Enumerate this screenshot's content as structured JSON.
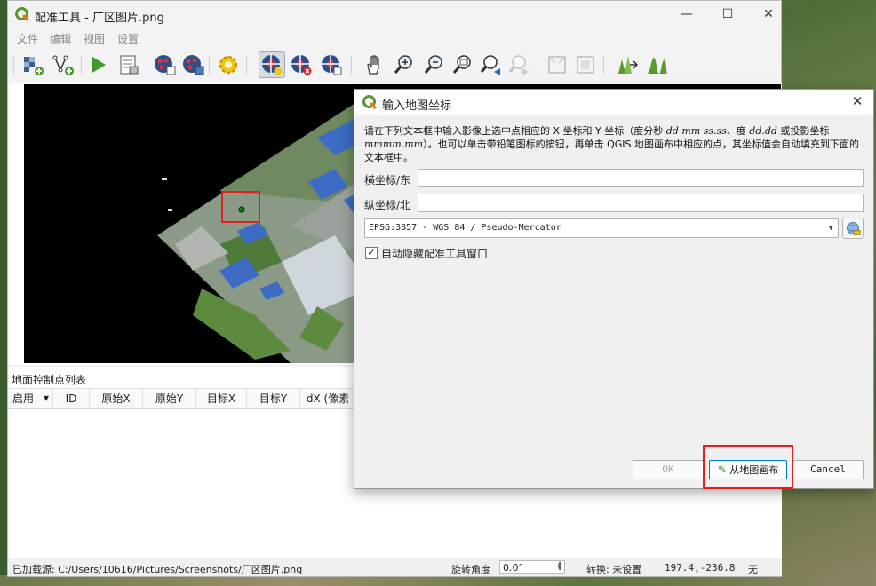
{
  "window": {
    "title": "配准工具 - 厂区图片.png",
    "controls": [
      "—",
      "☐",
      "✕"
    ]
  },
  "menu": [
    "文件",
    "编辑",
    "视图",
    "设置"
  ],
  "toolbar": {
    "icons": [
      "add-raster-icon",
      "add-point-icon",
      "run-icon",
      "generate-script-icon",
      "load-gcp-icon",
      "save-gcp-icon",
      "settings-icon",
      "add-point-tool-icon",
      "delete-point-icon",
      "move-gcp-icon",
      "pan-icon",
      "zoom-in-icon",
      "zoom-out-icon",
      "zoom-layer-icon",
      "zoom-last-icon",
      "zoom-next-icon",
      "link-georef-icon",
      "link-qgis-icon",
      "histogram-stretch-icon",
      "local-histogram-icon"
    ]
  },
  "gcp_panel": {
    "title": "地面控制点列表",
    "columns": [
      "启用",
      "ID",
      "原始X",
      "原始Y",
      "目标X",
      "目标Y",
      "dX (像素"
    ]
  },
  "status": {
    "loaded_source": "已加载源: C:/Users/10616/Pictures/Screenshots/厂区图片.png",
    "rotation_label": "旋转角度",
    "rotation_value": "0.0°",
    "transform_label": "转换: 未设置",
    "coords": "197.4,-236.8",
    "crs": "无"
  },
  "dialog": {
    "title": "输入地图坐标",
    "close": "✕",
    "description": {
      "p1": "请在下列文本框中输入影像上选中点相应的 X 坐标和 Y 坐标（度分秒 ",
      "i1": "dd mm ss.ss",
      "p2": "、度 ",
      "i2": "dd.dd",
      "p3": " 或投影坐标 ",
      "i3": "mmmm.mm",
      "p4": "）。也可以单击带铅笔图标的按钮，再单击 QGIS 地图画布中相应的点，其坐标值会自动填充到下面的文本框中。"
    },
    "x_label": "横坐标/东",
    "y_label": "纵坐标/北",
    "x_value": "",
    "y_value": "",
    "crs": "EPSG:3857 - WGS 84 / Pseudo-Mercator",
    "auto_hide_label": "自动隐藏配准工具窗口",
    "auto_hide_checked": true,
    "buttons": {
      "ok": "OK",
      "from_canvas": "从地图画布",
      "cancel": "Cancel"
    }
  },
  "colors": {
    "highlight": "#e02020",
    "accent_green": "#5b9a2f"
  }
}
